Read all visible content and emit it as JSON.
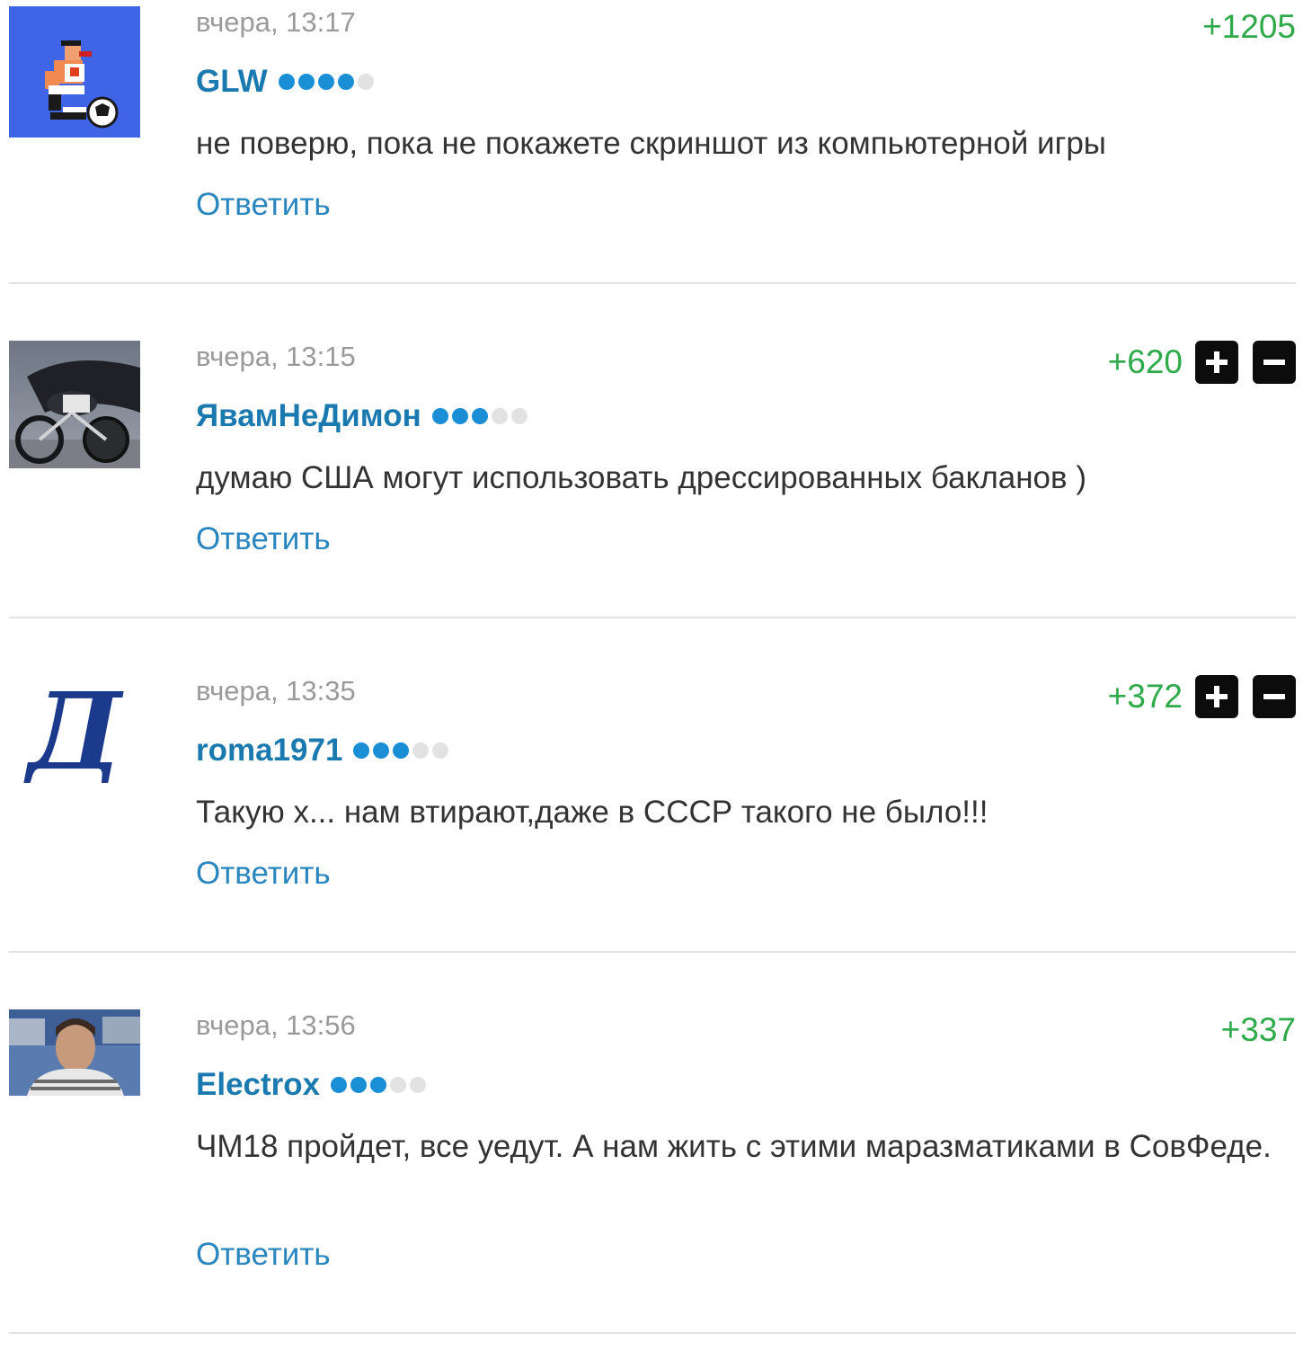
{
  "comments": [
    {
      "time": "вчера, 13:17",
      "author": "GLW",
      "rating_filled": 4,
      "rating_total": 5,
      "score": "+1205",
      "text": "не поверю, пока не покажете скриншот из компьютерной игры",
      "reply_label": "Ответить",
      "avatar_icon": "pixel-boxer-with-ball-avatar",
      "show_vote_buttons": false
    },
    {
      "time": "вчера, 13:15",
      "author": "ЯвамНеДимон",
      "rating_filled": 3,
      "rating_total": 5,
      "score": "+620",
      "text": "думаю США могут использовать дрессированных бакланов )",
      "reply_label": "Ответить",
      "avatar_icon": "cyclist-photo-avatar",
      "show_vote_buttons": true
    },
    {
      "time": "вчера, 13:35",
      "author": "roma1971",
      "rating_filled": 3,
      "rating_total": 5,
      "score": "+372",
      "text": "Такую х... нам втирают,даже в СССР такого не было!!!",
      "reply_label": "Ответить",
      "avatar_icon": "dynamo-logo-avatar",
      "show_vote_buttons": true
    },
    {
      "time": "вчера, 13:56",
      "author": "Electrox",
      "rating_filled": 3,
      "rating_total": 5,
      "score": "+337",
      "text": "ЧМ18 пройдет, все уедут. А нам жить с этими маразматиками в СовФеде.",
      "reply_label": "Ответить",
      "avatar_icon": "man-portrait-avatar",
      "show_vote_buttons": false
    }
  ],
  "colors": {
    "score_positive": "#2eaa4a",
    "author_link": "#1a7ab0",
    "reply_link": "#2a86be",
    "timestamp": "#9a9a9a",
    "rating_on": "#1a8fd6",
    "rating_off": "#e2e2e2",
    "vote_button": "#0c0c0c"
  }
}
